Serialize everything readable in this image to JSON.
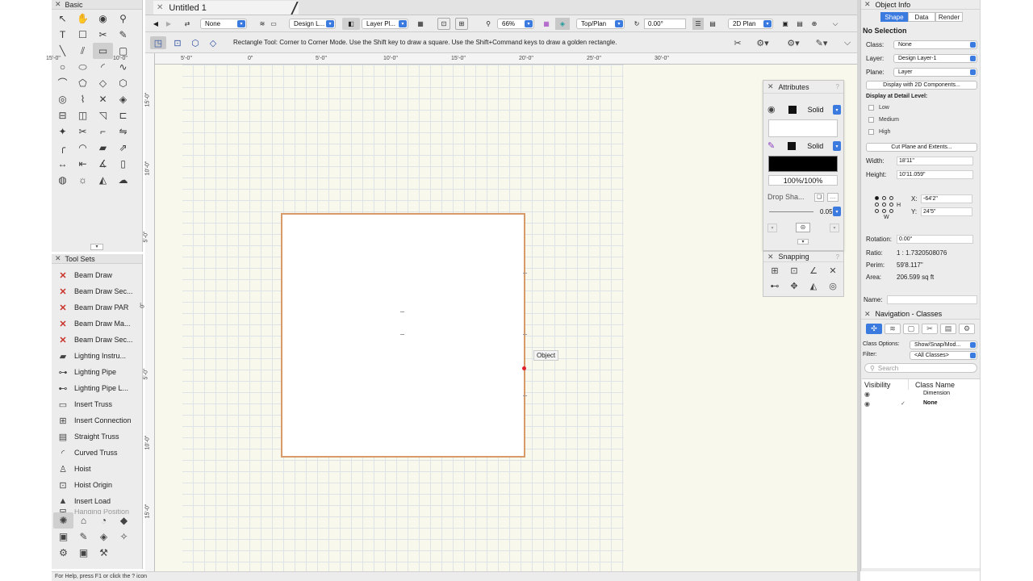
{
  "document": {
    "tab_title": "Untitled 1"
  },
  "palettes": {
    "basic_title": "Basic",
    "basic_tools": [
      "selection-arrow",
      "pan-hand",
      "flyover",
      "zoom",
      "text",
      "callout",
      "cut",
      "eyedropper",
      "line",
      "double-line",
      "rectangle",
      "rounded-rectangle",
      "circle",
      "oval",
      "arc",
      "freehand",
      "polyline",
      "polygon",
      "double-line-polygon",
      "regular-polygon",
      "spiral",
      "spline",
      "clip",
      "reshape",
      "trim",
      "fillet",
      "chamfer",
      "connect",
      "connect-combine",
      "split",
      "offset",
      "mirror",
      "arc-quarter",
      "arc-3pt",
      "pushpull",
      "extrude",
      "dimension",
      "constrained-dimension",
      "angular-dimension",
      "wall",
      "visualization",
      "sun",
      "heliodon",
      "cloud"
    ],
    "toolsets_title": "Tool Sets",
    "toolset_items": [
      {
        "label": "Beam Draw",
        "icon": "red-x"
      },
      {
        "label": "Beam Draw Sec...",
        "icon": "red-x"
      },
      {
        "label": "Beam Draw PAR",
        "icon": "red-x"
      },
      {
        "label": "Beam Draw Ma...",
        "icon": "red-x"
      },
      {
        "label": "Beam Draw Sec...",
        "icon": "red-x"
      },
      {
        "label": "Lighting Instru...",
        "icon": "lighting-instrument"
      },
      {
        "label": "Lighting Pipe",
        "icon": "lighting-pipe"
      },
      {
        "label": "Lighting Pipe L...",
        "icon": "lighting-pipe-ladder"
      },
      {
        "label": "Insert Truss",
        "icon": "truss"
      },
      {
        "label": "Insert Connection",
        "icon": "truss-connection"
      },
      {
        "label": "Straight Truss",
        "icon": "straight-truss"
      },
      {
        "label": "Curved Truss",
        "icon": "curved-truss"
      },
      {
        "label": "Hoist",
        "icon": "hoist"
      },
      {
        "label": "Hoist Origin",
        "icon": "hoist-origin"
      },
      {
        "label": "Insert Load",
        "icon": "load"
      },
      {
        "label": "Hanging Position",
        "icon": "hanging-position"
      }
    ],
    "toolset_icons": [
      "spotlight",
      "building",
      "machine-design",
      "landscape",
      "furniture",
      "dims-notes",
      "visualization",
      "detailing",
      "settings",
      "box",
      "tools"
    ]
  },
  "toolbar": {
    "class_value": "None",
    "layer_value": "Design L...",
    "layer_plane_value": "Layer Pl...",
    "zoom_value": "66%",
    "view_value": "Top/Plan",
    "rotation_value": "0.00°",
    "render_value": "2D Plan"
  },
  "modebar": {
    "hint": "Rectangle Tool: Corner to Corner Mode. Use the Shift key to draw a square. Use the Shift+Command keys to draw a golden rectangle."
  },
  "rulers": {
    "h_labels": [
      "15'-0\"",
      "10'-0\"",
      "5'-0\"",
      "0\"",
      "5'-0\"",
      "10'-0\"",
      "15'-0\"",
      "20'-0\"",
      "25'-0\"",
      "30'-0\""
    ],
    "v_labels": [
      "15'-0\"",
      "10'-0\"",
      "5'-0\"",
      "0\"",
      "5'-0\"",
      "10'-0\"",
      "15'-0\""
    ]
  },
  "canvas": {
    "snap_tooltip": "Object"
  },
  "attributes": {
    "title": "Attributes",
    "fill_style": "Solid",
    "pen_style": "Solid",
    "opacity": "100%/100%",
    "drop_shadow_label": "Drop Sha...",
    "line_weight": "0.05"
  },
  "snapping": {
    "title": "Snapping",
    "icons": [
      "snap-to-grid",
      "snap-to-object",
      "snap-to-angle",
      "snap-to-intersection",
      "snap-to-distance",
      "smart-points",
      "smart-edge",
      "snap-to-tangent"
    ]
  },
  "object_info": {
    "title": "Object Info",
    "tabs": [
      "Shape",
      "Data",
      "Render"
    ],
    "selection": "No Selection",
    "class_label": "Class:",
    "class_value": "None",
    "layer_label": "Layer:",
    "layer_value": "Design Layer-1",
    "plane_label": "Plane:",
    "plane_value": "Layer",
    "display_2d": "Display with 2D Components...",
    "detail_level": "Display at Detail Level:",
    "detail_low": "Low",
    "detail_medium": "Medium",
    "detail_high": "High",
    "cut_plane": "Cut Plane and Extents...",
    "width_label": "Width:",
    "width_value": "18'11\"",
    "height_label": "Height:",
    "height_value": "10'11.059\"",
    "x_label": "X:",
    "x_value": "-64'2\"",
    "y_label": "Y:",
    "y_value": "24'5\"",
    "h_label": "H",
    "w_label": "W",
    "rotation_label": "Rotation:",
    "rotation_value": "0.00°",
    "ratio_label": "Ratio:",
    "ratio_value": "1 : 1.7320508076",
    "perim_label": "Perim:",
    "perim_value": "59'8.117\"",
    "area_label": "Area:",
    "area_value": "206.599 sq ft",
    "name_label": "Name:"
  },
  "navigation": {
    "title": "Navigation - Classes",
    "class_options_label": "Class Options:",
    "class_options_value": "Show/Snap/Mod...",
    "filter_label": "Filter:",
    "filter_value": "<All Classes>",
    "search_placeholder": "Search",
    "col_visibility": "Visibility",
    "col_class_name": "Class Name",
    "rows": [
      {
        "name": "Dimension",
        "bold": false
      },
      {
        "name": "None",
        "bold": true
      }
    ]
  },
  "status": {
    "help": "For Help, press F1 or click the ? icon"
  }
}
